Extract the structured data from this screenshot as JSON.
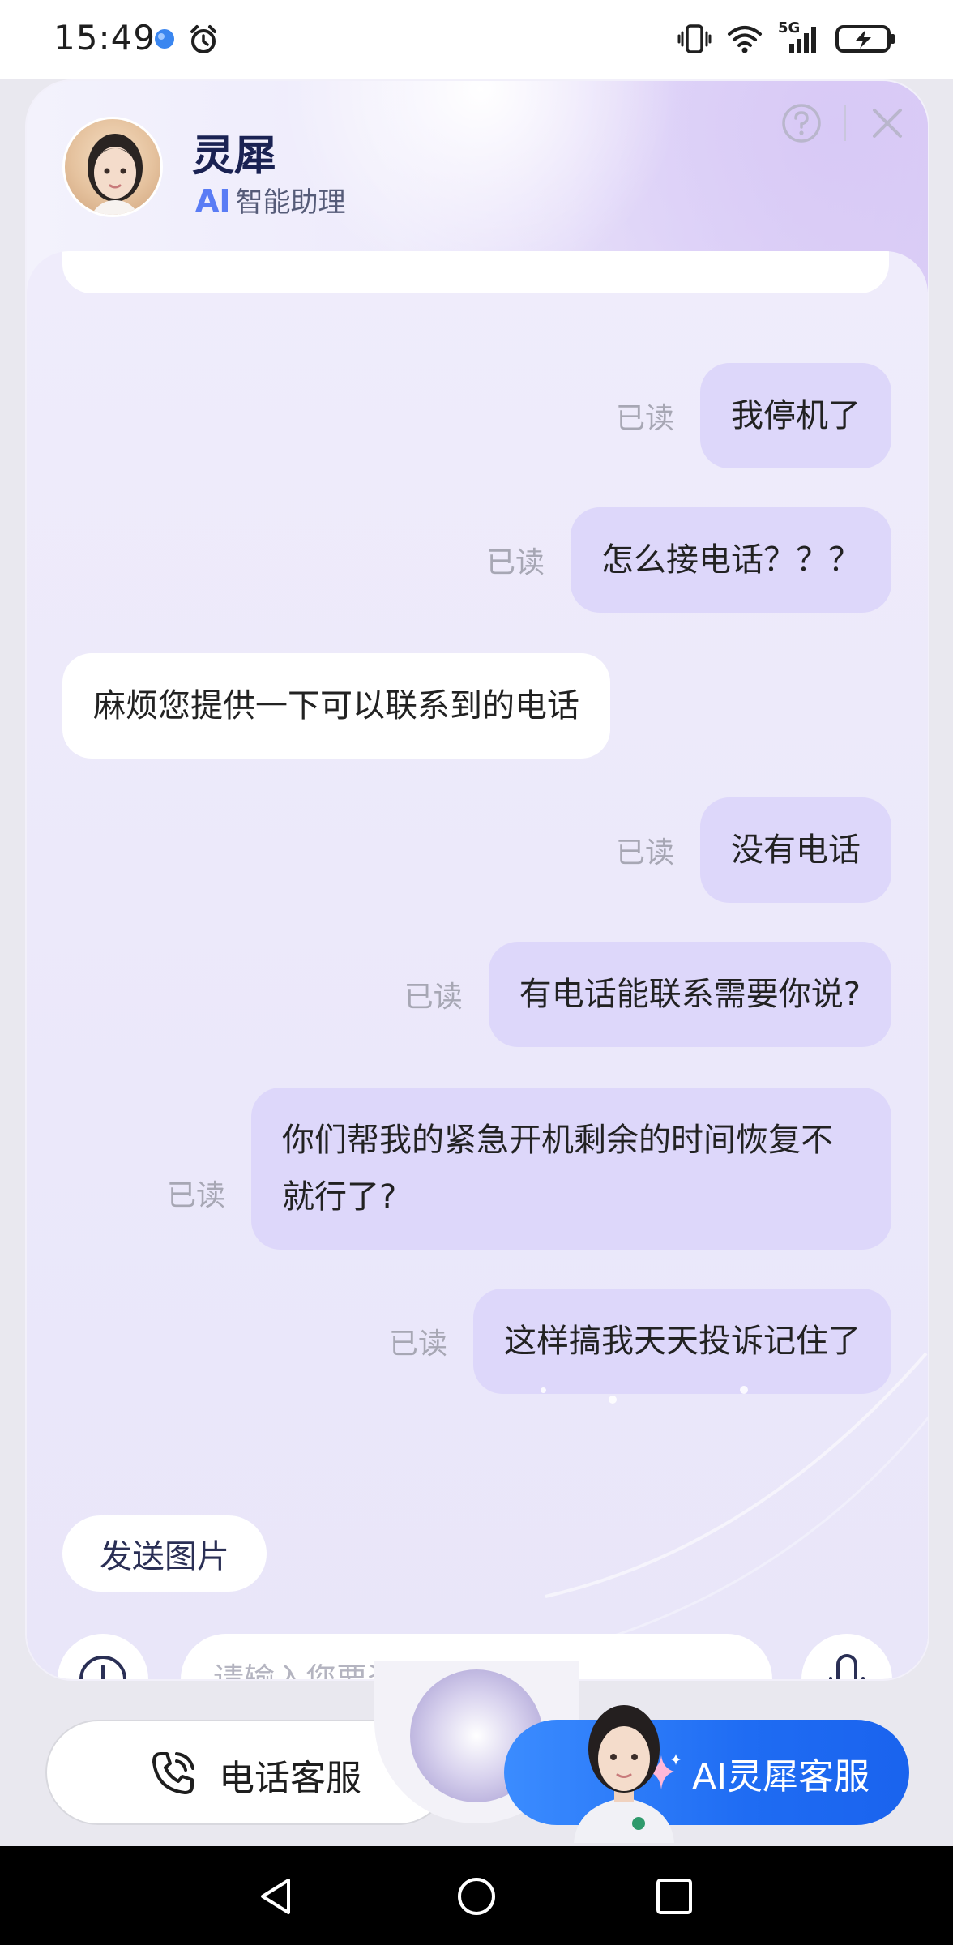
{
  "status_bar": {
    "time": "15:49",
    "left_icons": [
      "blue-dot-app-icon",
      "alarm-icon"
    ],
    "right_icons": [
      "vibrate-icon",
      "wifi-icon",
      "signal-5g-icon",
      "battery-charging-icon"
    ],
    "network_label": "5G"
  },
  "header": {
    "title": "灵犀",
    "subtitle_prefix": "AI",
    "subtitle": "智能助理",
    "icons": [
      "avatar",
      "help-icon",
      "close-icon"
    ]
  },
  "messages": [
    {
      "from": "user",
      "text": "我停机了",
      "status": "已读"
    },
    {
      "from": "user",
      "text": "怎么接电话？？？",
      "status": "已读"
    },
    {
      "from": "bot",
      "text": "麻烦您提供一下可以联系到的电话"
    },
    {
      "from": "user",
      "text": "没有电话",
      "status": "已读"
    },
    {
      "from": "user",
      "text": "有电话能联系需要你说?",
      "status": "已读"
    },
    {
      "from": "user",
      "text": "你们帮我的紧急开机剩余的时间恢复不就行了?",
      "status": "已读"
    },
    {
      "from": "user",
      "text": "这样搞我天天投诉记住了",
      "status": "已读"
    }
  ],
  "quick_action": {
    "label": "发送图片"
  },
  "input": {
    "placeholder": "请输入您要咨询的内容",
    "value": ""
  },
  "bottom_bar": {
    "phone_service_label": "电话客服",
    "ai_service_label": "AI灵犀客服"
  },
  "colors": {
    "user_bubble": "#ddd7fa",
    "bot_bubble": "#ffffff",
    "accent_blue": "#1f6cf3",
    "title": "#1a2253"
  }
}
